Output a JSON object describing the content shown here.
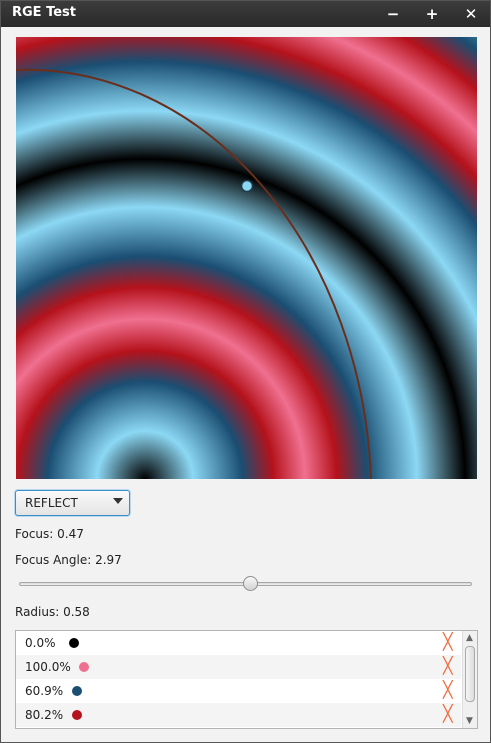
{
  "window": {
    "title": "RGE Test",
    "minimize_label": "−",
    "maximize_label": "+",
    "close_label": "✕"
  },
  "gradient": {
    "cycle_method": "REFLECT",
    "focus": 0.47,
    "focus_angle": 2.97,
    "radius": 0.58,
    "focus_angle_slider_fraction": 0.51
  },
  "controls": {
    "cycle_combo_value": "REFLECT",
    "focus_label": "Focus: 0.47",
    "focus_angle_label": "Focus Angle: 2.97",
    "radius_label": "Radius: 0.58"
  },
  "stops": [
    {
      "label": "0.0%",
      "color": "#000000",
      "delete_label": "╳"
    },
    {
      "label": "100.0%",
      "color": "#f07090",
      "delete_label": "╳"
    },
    {
      "label": "60.9%",
      "color": "#1a4e72",
      "delete_label": "╳"
    },
    {
      "label": "80.2%",
      "color": "#b5121b",
      "delete_label": "╳"
    }
  ],
  "icons": {
    "combo_arrow": "chevron-down-icon",
    "scroll_up": "chevron-up-icon",
    "scroll_down": "chevron-down-icon",
    "delete": "delete-icon"
  }
}
